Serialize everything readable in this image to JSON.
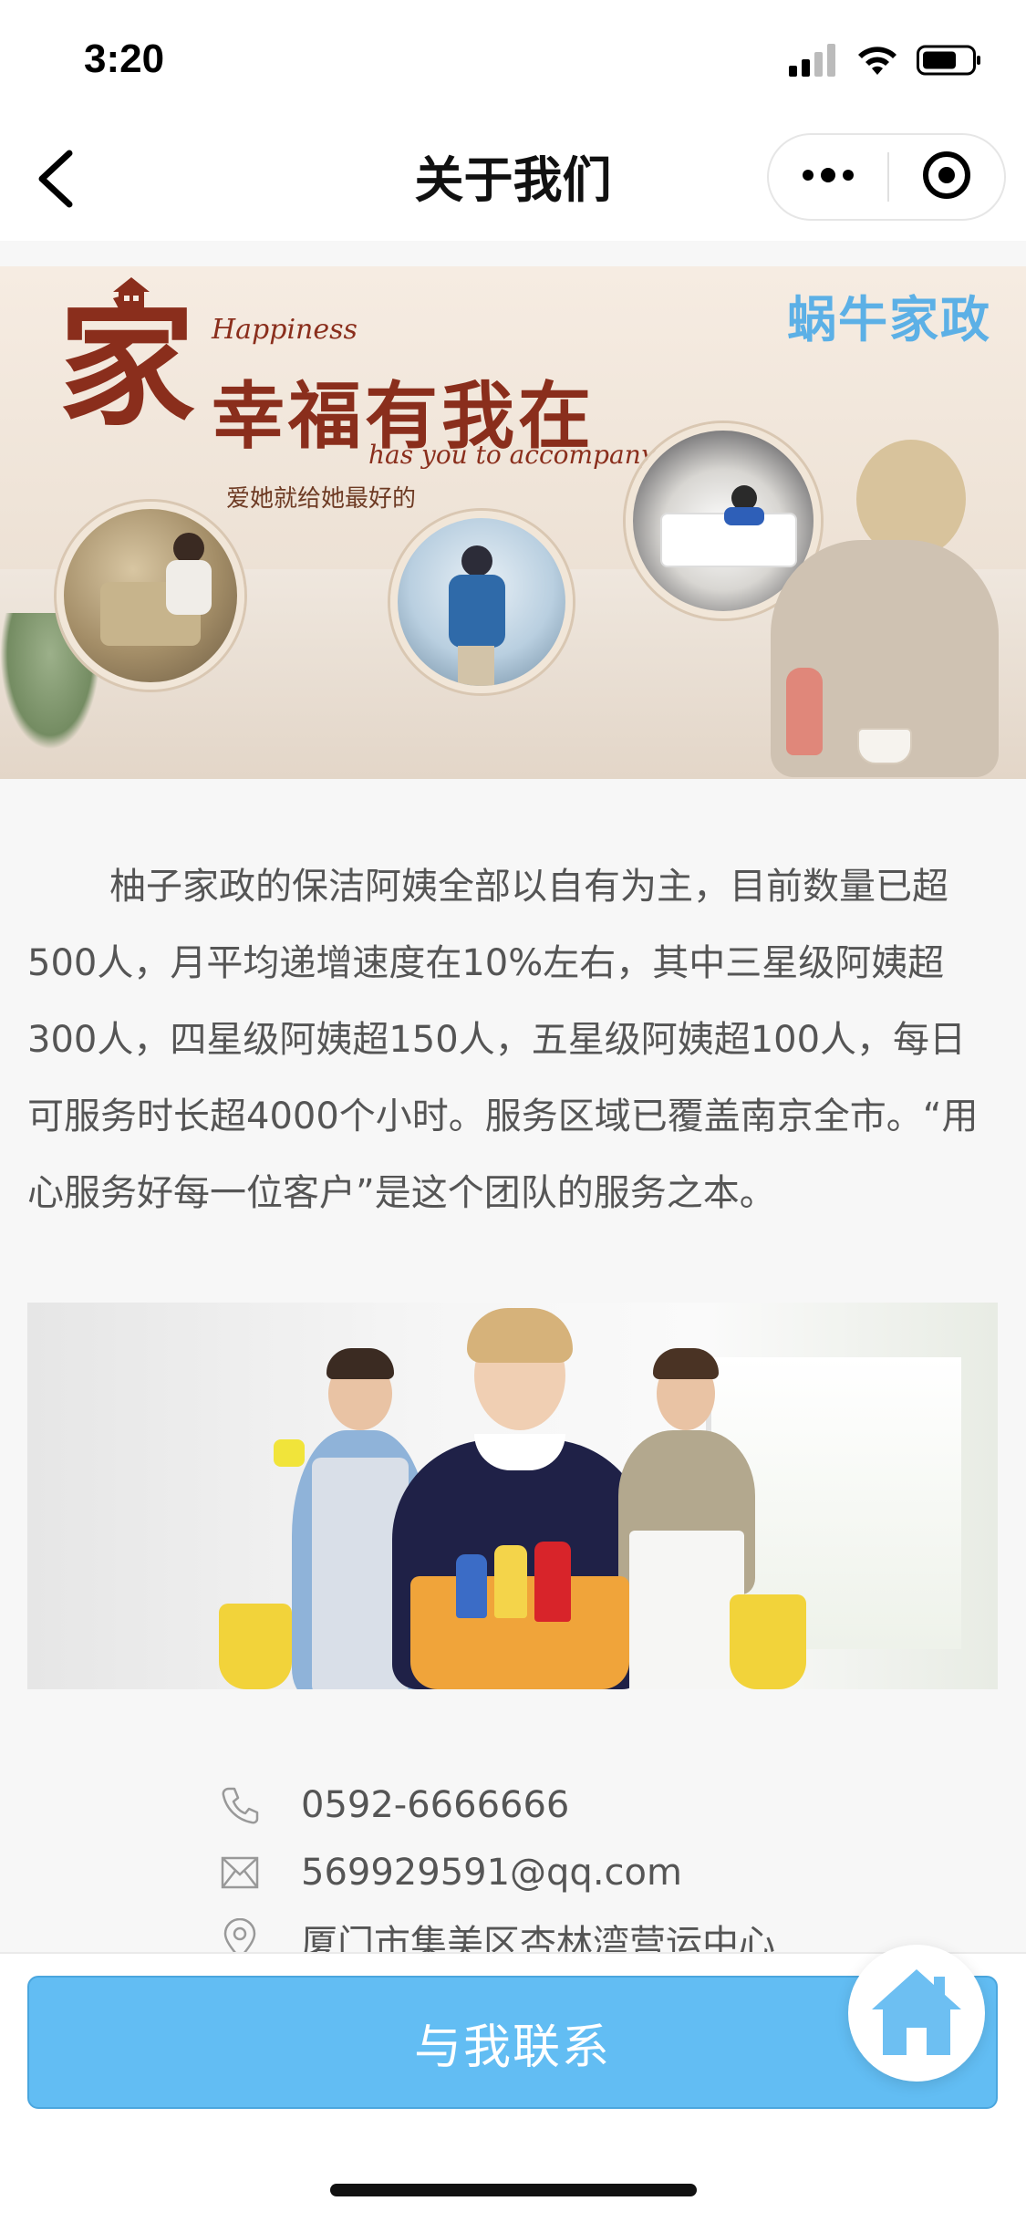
{
  "status_bar": {
    "time": "3:20",
    "icons": [
      "signal-icon",
      "wifi-icon",
      "battery-icon"
    ]
  },
  "nav": {
    "title": "关于我们",
    "back_icon": "chevron-left-icon",
    "capsule": [
      "more-dots-icon",
      "close-target-icon"
    ]
  },
  "banner": {
    "brand": "蜗牛家政",
    "big_char": "家",
    "happiness": "Happiness",
    "slogan": "幸福有我在",
    "accompany": "has you to accompany",
    "subtitle": "爱她就给她最好的"
  },
  "intro": {
    "text": "柚子家政的保洁阿姨全部以自有为主，目前数量已超500人，月平均递增速度在10%左右，其中三星级阿姨超300人，四星级阿姨超150人，五星级阿姨超100人，每日可服务时长超4000个小时。服务区域已覆盖南京全市。“用心服务好每一位客户”是这个团队的服务之本。"
  },
  "contacts": [
    {
      "icon": "phone-icon",
      "text": "0592-6666666"
    },
    {
      "icon": "mail-icon",
      "text": "569929591@qq.com"
    },
    {
      "icon": "location-icon",
      "text": "厦门市集美区杏林湾营运中心"
    }
  ],
  "bottom": {
    "button_label": "与我联系",
    "fab_icon": "home-icon"
  },
  "colors": {
    "accent": "#62bdf3",
    "brand_text": "#5cb0e6",
    "banner_text": "#8a2e1c",
    "home_icon": "#6dbff2"
  }
}
